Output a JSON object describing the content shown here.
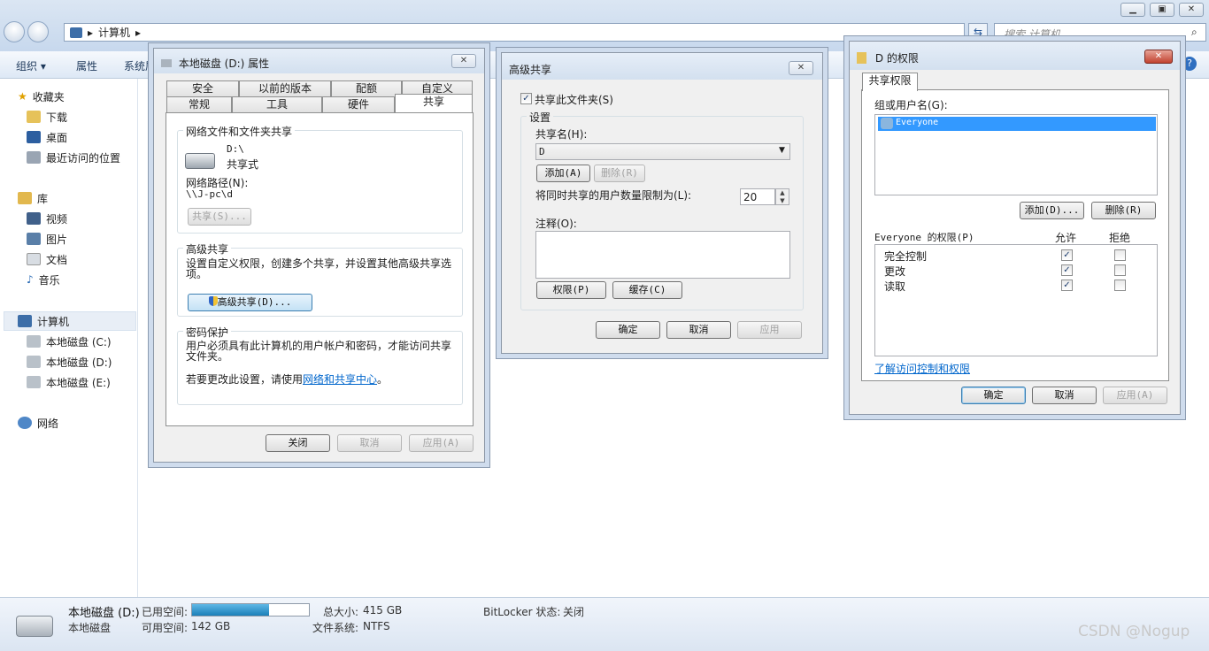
{
  "explorer": {
    "breadcrumb": "计算机",
    "search_placeholder": "搜索 计算机",
    "toolbar": {
      "organize": "组织",
      "properties": "属性",
      "system": "系统属"
    },
    "sidebar": {
      "favorites": "收藏夹",
      "downloads": "下载",
      "desktop": "桌面",
      "recent": "最近访问的位置",
      "libraries": "库",
      "videos": "视频",
      "pictures": "图片",
      "documents": "文档",
      "music": "音乐",
      "computer": "计算机",
      "drive_c": "本地磁盘 (C:)",
      "drive_d": "本地磁盘 (D:)",
      "drive_e": "本地磁盘 (E:)",
      "network": "网络"
    },
    "status": {
      "name": "本地磁盘 (D:)",
      "type": "本地磁盘",
      "used_label": "已用空间:",
      "free_label": "可用空间:",
      "free_value": "142 GB",
      "total_label": "总大小:",
      "total_value": "415 GB",
      "fs_label": "文件系统:",
      "fs_value": "NTFS",
      "bitlocker_label": "BitLocker 状态:",
      "bitlocker_value": "关闭",
      "used_fraction": 0.66
    },
    "watermark": "CSDN @Nogup"
  },
  "props": {
    "title": "本地磁盘 (D:) 属性",
    "tabs_row1": [
      "安全",
      "以前的版本",
      "配额",
      "自定义"
    ],
    "tabs_row2": [
      "常规",
      "工具",
      "硬件",
      "共享"
    ],
    "net_group": "网络文件和文件夹共享",
    "path": "D:\\",
    "share_state": "共享式",
    "net_path_label": "网络路径(N):",
    "net_path": "\\\\J-pc\\d",
    "share_btn": "共享(S)...",
    "adv_group": "高级共享",
    "adv_desc": "设置自定义权限，创建多个共享，并设置其他高级共享选项。",
    "adv_btn": "高级共享(D)...",
    "pw_group": "密码保护",
    "pw_desc": "用户必须具有此计算机的用户帐户和密码，才能访问共享文件夹。",
    "pw_change": "若要更改此设置，请使用",
    "pw_link": "网络和共享中心",
    "pw_end": "。",
    "close": "关闭",
    "cancel": "取消",
    "apply": "应用(A)"
  },
  "adv": {
    "title": "高级共享",
    "share_check": "共享此文件夹(S)",
    "settings": "设置",
    "share_name_label": "共享名(H):",
    "share_name": "D",
    "add": "添加(A)",
    "remove": "删除(R)",
    "limit_label": "将同时共享的用户数量限制为(L):",
    "limit_value": "20",
    "comment_label": "注释(O):",
    "perm_btn": "权限(P)",
    "cache_btn": "缓存(C)",
    "ok": "确定",
    "cancel": "取消",
    "apply": "应用"
  },
  "perm": {
    "title": "D 的权限",
    "tab": "共享权限",
    "group_label": "组或用户名(G):",
    "user": "Everyone",
    "add": "添加(D)...",
    "remove": "删除(R)",
    "perm_label": "Everyone 的权限(P)",
    "allow": "允许",
    "deny": "拒绝",
    "rows": [
      {
        "name": "完全控制",
        "allow": true,
        "deny": false
      },
      {
        "name": "更改",
        "allow": true,
        "deny": false
      },
      {
        "name": "读取",
        "allow": true,
        "deny": false
      }
    ],
    "learn": "了解访问控制和权限",
    "ok": "确定",
    "cancel": "取消",
    "apply": "应用(A)"
  }
}
